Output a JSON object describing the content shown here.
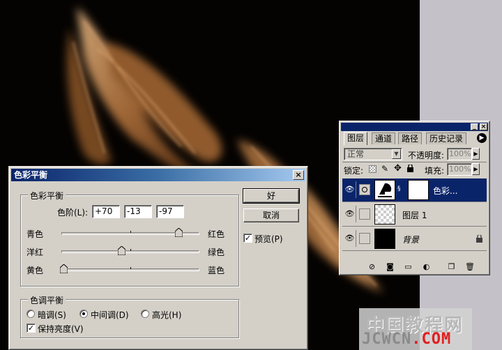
{
  "dialog": {
    "title": "色彩平衡",
    "balance_group": "色彩平衡",
    "levels_label": "色阶(L):",
    "levels": [
      "+70",
      "-13",
      "-97"
    ],
    "sliders": [
      {
        "left": "青色",
        "right": "红色",
        "value": 70
      },
      {
        "left": "洋红",
        "right": "绿色",
        "value": -13
      },
      {
        "left": "黄色",
        "right": "蓝色",
        "value": -97
      }
    ],
    "tone_group": "色调平衡",
    "tone_options": [
      {
        "label": "暗调(S)",
        "selected": false
      },
      {
        "label": "中间调(D)",
        "selected": true
      },
      {
        "label": "高光(H)",
        "selected": false
      }
    ],
    "preserve_luminosity": "保持亮度(V)",
    "preserve_checked": true,
    "ok": "好",
    "cancel": "取消",
    "preview": "预览(P)",
    "preview_checked": true,
    "close_icon": "close-icon"
  },
  "layers_palette": {
    "tabs": [
      "图层",
      "通道",
      "路径",
      "历史记录"
    ],
    "blend_mode": "正常",
    "opacity_label": "不透明度:",
    "opacity_value": "100%",
    "lock_label": "锁定:",
    "fill_label": "填充:",
    "fill_value": "100%",
    "layers": [
      {
        "name": "色彩...",
        "type": "adjustment",
        "selected": true
      },
      {
        "name": "图层 1",
        "type": "transparent",
        "selected": false
      },
      {
        "name": "背景",
        "type": "background",
        "selected": false,
        "locked": true
      }
    ]
  },
  "watermark": {
    "line1": "中国教程网",
    "line2_a": "JCWCN",
    "line2_b": ".COM"
  },
  "colors": {
    "title_start": "#0a246a",
    "title_end": "#a6caf0",
    "face": "#d4d0c8",
    "fire": "#c8864a"
  }
}
